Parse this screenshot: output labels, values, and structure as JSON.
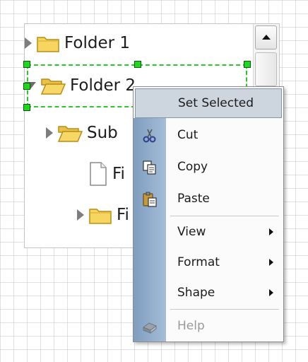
{
  "tree": {
    "nodes": [
      {
        "label": "Folder 1",
        "expander": "collapsed",
        "icon": "folder-icon"
      },
      {
        "label": "Folder 2",
        "expander": "expanded",
        "icon": "open-folder-icon"
      },
      {
        "label": "Sub",
        "expander": "collapsed",
        "icon": "open-folder-icon"
      },
      {
        "label": "Fi",
        "expander": "none",
        "icon": "file-icon"
      },
      {
        "label": "Fi",
        "expander": "collapsed",
        "icon": "folder-icon"
      }
    ]
  },
  "scrollbar": {
    "up_icon": "scroll-up-arrow-icon"
  },
  "context_menu": {
    "items": [
      {
        "label": "Set Selected",
        "icon": null
      },
      {
        "label": "Cut",
        "icon": "scissors-icon"
      },
      {
        "label": "Copy",
        "icon": "copy-icon"
      },
      {
        "label": "Paste",
        "icon": "paste-icon"
      },
      {
        "label": "View",
        "submenu": true
      },
      {
        "label": "Format",
        "submenu": true
      },
      {
        "label": "Shape",
        "submenu": true
      },
      {
        "label": "Help",
        "icon": "help-book-icon",
        "disabled": true
      }
    ]
  },
  "colors": {
    "selection": "#28c928",
    "folder": "#f2cf55",
    "menu_gutter": "#8fa9c9"
  }
}
